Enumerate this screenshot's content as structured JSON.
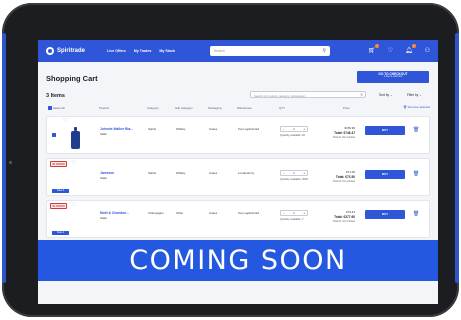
{
  "nav": {
    "brand": "Spiritrade",
    "links": [
      "Live Offers",
      "My Trades",
      "My Stock"
    ],
    "search_placeholder": "Search"
  },
  "colors": {
    "brand_blue": "#2f56d8",
    "banner_blue": "#2458e1",
    "alert_red": "#d43a3a"
  },
  "cart": {
    "title": "Shopping Cart",
    "checkout_label": "GO TO CHECKOUT",
    "checkout_sub": "3 items selected",
    "items_count": "3 Items",
    "filter_placeholder": "Search for product, category, subcategory",
    "sort_label": "Sort by",
    "filter_label": "Filter by",
    "columns": [
      "Select All",
      "Product",
      "Category",
      "Sub Category",
      "Packaging",
      "Warehouse",
      "QTY",
      "Price"
    ],
    "remove_all": "Remove selected",
    "rows": [
      {
        "badge": "",
        "name": "Johnnie Walker Bla...",
        "seller": "Seller",
        "category": "Spirits",
        "subcategory": "Whisky",
        "packaging": "Cases",
        "warehouse": "Top Logistics Ed",
        "qty": "1",
        "qty_available": "Quantity available: 20",
        "unit_price": "€159.99",
        "total": "Total: €746.47",
        "note": "Total for 20 included",
        "buy": "BUY",
        "save": ""
      },
      {
        "badge": "BLOCKED",
        "name": "Jameson",
        "seller": "Seller",
        "category": "Spirits",
        "subcategory": "Whisky",
        "packaging": "Cases",
        "warehouse": "Londonderry",
        "qty": "1",
        "qty_available": "Quantity available: 3000",
        "unit_price": "€71.00",
        "total": "Total: €73.50",
        "note": "Total for 10 included",
        "buy": "BUY",
        "save": "Save it"
      },
      {
        "badge": "BLOCKED",
        "name": "Moët & Chandon...",
        "seller": "Seller",
        "category": "Champagne",
        "subcategory": "Other",
        "packaging": "Cases",
        "warehouse": "Top Logistics Ed",
        "qty": "1",
        "qty_available": "Quantity available: 7",
        "unit_price": "€79.43",
        "total": "Total: €377.60",
        "note": "Total for 10 included",
        "buy": "BUY",
        "save": "Save it"
      }
    ]
  },
  "banner": {
    "text": "COMING SOON"
  },
  "icons": [
    "logo-icon",
    "search-icon",
    "cart-icon",
    "heart-icon",
    "bell-icon",
    "user-icon",
    "trash-icon",
    "chevron-down-icon"
  ]
}
